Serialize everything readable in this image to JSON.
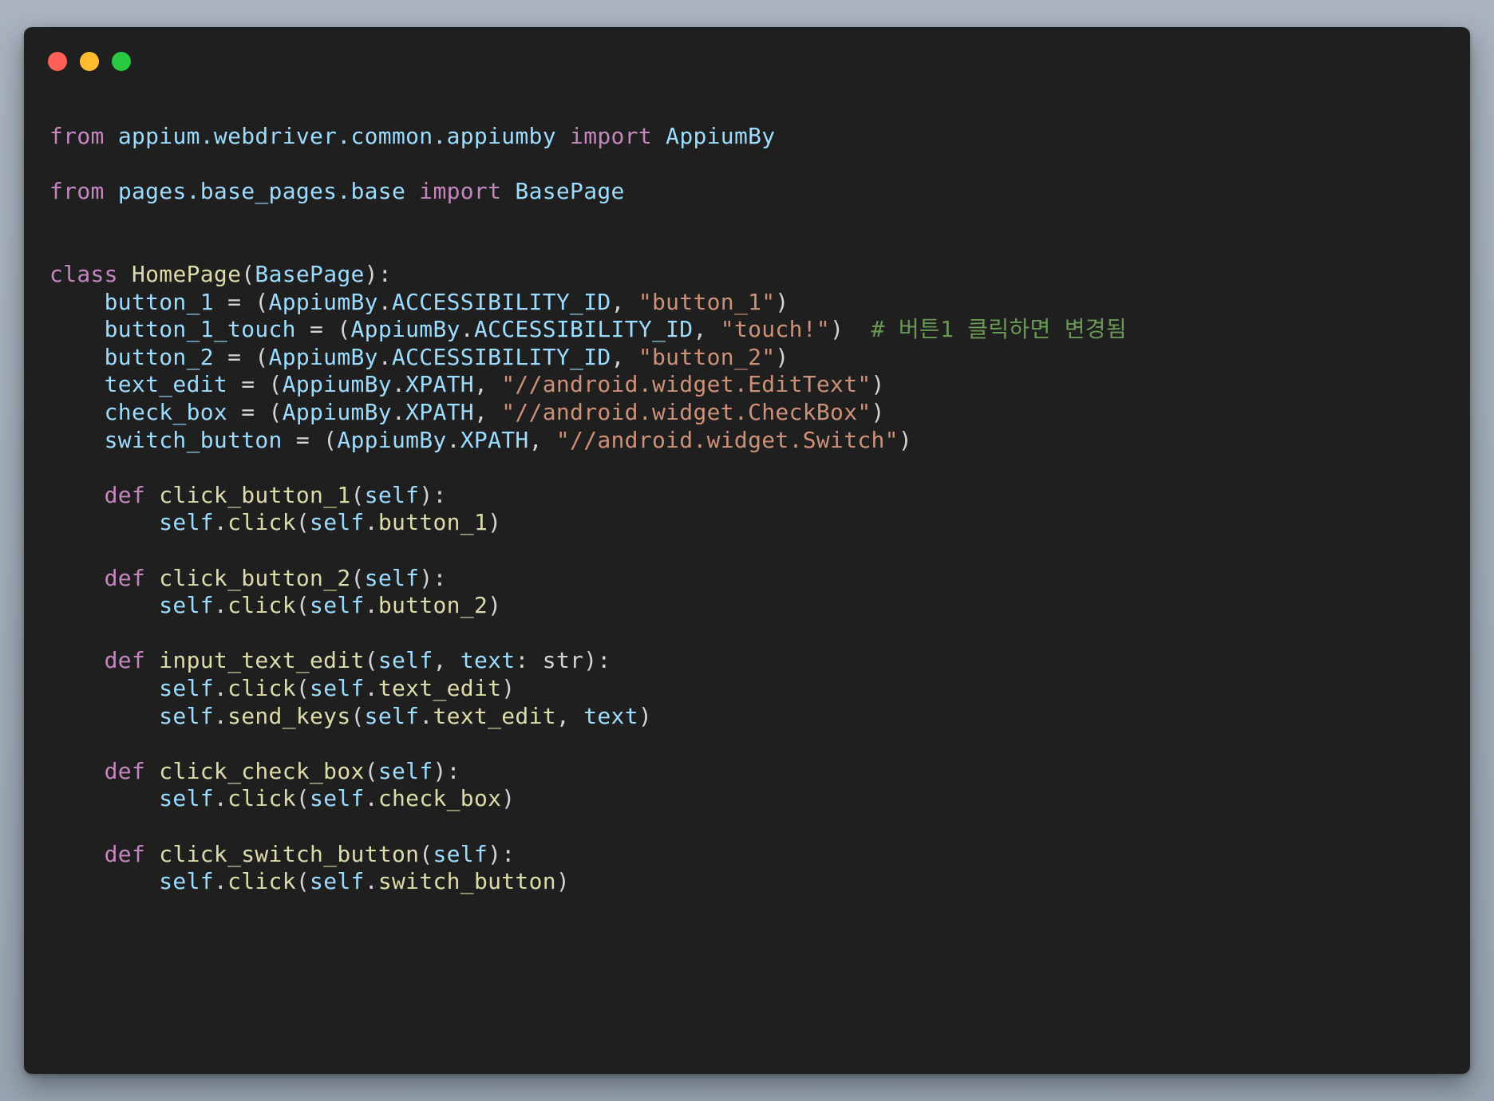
{
  "theme": {
    "background": "#1f1f1f",
    "traffic_lights": {
      "close": "#fe5f57",
      "minimize": "#febc2e",
      "maximize": "#28c840"
    },
    "token_colors": {
      "kw": "#c586c0",
      "mod": "#9cdcfe",
      "cls": "#4ec9b0",
      "fn": "#dcdcaa",
      "var": "#9cdcfe",
      "self": "#9cdcfe",
      "str": "#ce9178",
      "com": "#6a9955",
      "punc": "#d4d4d4",
      "builtin": "#d4d4d4",
      "plain": "#d4d4d4"
    }
  },
  "window_controls": {
    "close_icon": "red-circle",
    "minimize_icon": "yellow-circle",
    "maximize_icon": "green-circle"
  },
  "code_lines": [
    {
      "line": 1,
      "tokens": [
        {
          "t": "kw",
          "v": "from"
        },
        {
          "t": "plain",
          "v": " "
        },
        {
          "t": "mod",
          "v": "appium.webdriver.common.appiumby"
        },
        {
          "t": "plain",
          "v": " "
        },
        {
          "t": "kw",
          "v": "import"
        },
        {
          "t": "plain",
          "v": " "
        },
        {
          "t": "mod",
          "v": "AppiumBy"
        }
      ]
    },
    {
      "line": 3,
      "tokens": [
        {
          "t": "kw",
          "v": "from"
        },
        {
          "t": "plain",
          "v": " "
        },
        {
          "t": "mod",
          "v": "pages.base_pages.base"
        },
        {
          "t": "plain",
          "v": " "
        },
        {
          "t": "kw",
          "v": "import"
        },
        {
          "t": "plain",
          "v": " "
        },
        {
          "t": "mod",
          "v": "BasePage"
        }
      ]
    },
    {
      "line": 6,
      "tokens": [
        {
          "t": "kw",
          "v": "class"
        },
        {
          "t": "plain",
          "v": " "
        },
        {
          "t": "fn",
          "v": "HomePage"
        },
        {
          "t": "punc",
          "v": "("
        },
        {
          "t": "mod",
          "v": "BasePage"
        },
        {
          "t": "punc",
          "v": "):"
        }
      ]
    },
    {
      "line": 7,
      "tokens": [
        {
          "t": "plain",
          "v": "    "
        },
        {
          "t": "var",
          "v": "button_1"
        },
        {
          "t": "punc",
          "v": " = ("
        },
        {
          "t": "var",
          "v": "AppiumBy"
        },
        {
          "t": "punc",
          "v": "."
        },
        {
          "t": "var",
          "v": "ACCESSIBILITY_ID"
        },
        {
          "t": "punc",
          "v": ", "
        },
        {
          "t": "str",
          "v": "\"button_1\""
        },
        {
          "t": "punc",
          "v": ")"
        }
      ]
    },
    {
      "line": 8,
      "tokens": [
        {
          "t": "plain",
          "v": "    "
        },
        {
          "t": "var",
          "v": "button_1_touch"
        },
        {
          "t": "punc",
          "v": " = ("
        },
        {
          "t": "var",
          "v": "AppiumBy"
        },
        {
          "t": "punc",
          "v": "."
        },
        {
          "t": "var",
          "v": "ACCESSIBILITY_ID"
        },
        {
          "t": "punc",
          "v": ", "
        },
        {
          "t": "str",
          "v": "\"touch!\""
        },
        {
          "t": "punc",
          "v": ")  "
        },
        {
          "t": "com",
          "v": "# 버튼1 클릭하면 변경됨"
        }
      ]
    },
    {
      "line": 9,
      "tokens": [
        {
          "t": "plain",
          "v": "    "
        },
        {
          "t": "var",
          "v": "button_2"
        },
        {
          "t": "punc",
          "v": " = ("
        },
        {
          "t": "var",
          "v": "AppiumBy"
        },
        {
          "t": "punc",
          "v": "."
        },
        {
          "t": "var",
          "v": "ACCESSIBILITY_ID"
        },
        {
          "t": "punc",
          "v": ", "
        },
        {
          "t": "str",
          "v": "\"button_2\""
        },
        {
          "t": "punc",
          "v": ")"
        }
      ]
    },
    {
      "line": 10,
      "tokens": [
        {
          "t": "plain",
          "v": "    "
        },
        {
          "t": "var",
          "v": "text_edit"
        },
        {
          "t": "punc",
          "v": " = ("
        },
        {
          "t": "var",
          "v": "AppiumBy"
        },
        {
          "t": "punc",
          "v": "."
        },
        {
          "t": "var",
          "v": "XPATH"
        },
        {
          "t": "punc",
          "v": ", "
        },
        {
          "t": "str",
          "v": "\"//android.widget.EditText\""
        },
        {
          "t": "punc",
          "v": ")"
        }
      ]
    },
    {
      "line": 11,
      "tokens": [
        {
          "t": "plain",
          "v": "    "
        },
        {
          "t": "var",
          "v": "check_box"
        },
        {
          "t": "punc",
          "v": " = ("
        },
        {
          "t": "var",
          "v": "AppiumBy"
        },
        {
          "t": "punc",
          "v": "."
        },
        {
          "t": "var",
          "v": "XPATH"
        },
        {
          "t": "punc",
          "v": ", "
        },
        {
          "t": "str",
          "v": "\"//android.widget.CheckBox\""
        },
        {
          "t": "punc",
          "v": ")"
        }
      ]
    },
    {
      "line": 12,
      "tokens": [
        {
          "t": "plain",
          "v": "    "
        },
        {
          "t": "var",
          "v": "switch_button"
        },
        {
          "t": "punc",
          "v": " = ("
        },
        {
          "t": "var",
          "v": "AppiumBy"
        },
        {
          "t": "punc",
          "v": "."
        },
        {
          "t": "var",
          "v": "XPATH"
        },
        {
          "t": "punc",
          "v": ", "
        },
        {
          "t": "str",
          "v": "\"//android.widget.Switch\""
        },
        {
          "t": "punc",
          "v": ")"
        }
      ]
    },
    {
      "line": 14,
      "tokens": [
        {
          "t": "plain",
          "v": "    "
        },
        {
          "t": "kw",
          "v": "def"
        },
        {
          "t": "plain",
          "v": " "
        },
        {
          "t": "fn",
          "v": "click_button_1"
        },
        {
          "t": "punc",
          "v": "("
        },
        {
          "t": "self",
          "v": "self"
        },
        {
          "t": "punc",
          "v": "):"
        }
      ]
    },
    {
      "line": 15,
      "tokens": [
        {
          "t": "plain",
          "v": "        "
        },
        {
          "t": "self",
          "v": "self"
        },
        {
          "t": "punc",
          "v": "."
        },
        {
          "t": "fn",
          "v": "click"
        },
        {
          "t": "punc",
          "v": "("
        },
        {
          "t": "self",
          "v": "self"
        },
        {
          "t": "punc",
          "v": "."
        },
        {
          "t": "fn",
          "v": "button_1"
        },
        {
          "t": "punc",
          "v": ")"
        }
      ]
    },
    {
      "line": 17,
      "tokens": [
        {
          "t": "plain",
          "v": "    "
        },
        {
          "t": "kw",
          "v": "def"
        },
        {
          "t": "plain",
          "v": " "
        },
        {
          "t": "fn",
          "v": "click_button_2"
        },
        {
          "t": "punc",
          "v": "("
        },
        {
          "t": "self",
          "v": "self"
        },
        {
          "t": "punc",
          "v": "):"
        }
      ]
    },
    {
      "line": 18,
      "tokens": [
        {
          "t": "plain",
          "v": "        "
        },
        {
          "t": "self",
          "v": "self"
        },
        {
          "t": "punc",
          "v": "."
        },
        {
          "t": "fn",
          "v": "click"
        },
        {
          "t": "punc",
          "v": "("
        },
        {
          "t": "self",
          "v": "self"
        },
        {
          "t": "punc",
          "v": "."
        },
        {
          "t": "fn",
          "v": "button_2"
        },
        {
          "t": "punc",
          "v": ")"
        }
      ]
    },
    {
      "line": 20,
      "tokens": [
        {
          "t": "plain",
          "v": "    "
        },
        {
          "t": "kw",
          "v": "def"
        },
        {
          "t": "plain",
          "v": " "
        },
        {
          "t": "fn",
          "v": "input_text_edit"
        },
        {
          "t": "punc",
          "v": "("
        },
        {
          "t": "self",
          "v": "self"
        },
        {
          "t": "punc",
          "v": ", "
        },
        {
          "t": "var",
          "v": "text"
        },
        {
          "t": "punc",
          "v": ": "
        },
        {
          "t": "builtin",
          "v": "str"
        },
        {
          "t": "punc",
          "v": "):"
        }
      ]
    },
    {
      "line": 21,
      "tokens": [
        {
          "t": "plain",
          "v": "        "
        },
        {
          "t": "self",
          "v": "self"
        },
        {
          "t": "punc",
          "v": "."
        },
        {
          "t": "fn",
          "v": "click"
        },
        {
          "t": "punc",
          "v": "("
        },
        {
          "t": "self",
          "v": "self"
        },
        {
          "t": "punc",
          "v": "."
        },
        {
          "t": "fn",
          "v": "text_edit"
        },
        {
          "t": "punc",
          "v": ")"
        }
      ]
    },
    {
      "line": 22,
      "tokens": [
        {
          "t": "plain",
          "v": "        "
        },
        {
          "t": "self",
          "v": "self"
        },
        {
          "t": "punc",
          "v": "."
        },
        {
          "t": "fn",
          "v": "send_keys"
        },
        {
          "t": "punc",
          "v": "("
        },
        {
          "t": "self",
          "v": "self"
        },
        {
          "t": "punc",
          "v": "."
        },
        {
          "t": "fn",
          "v": "text_edit"
        },
        {
          "t": "punc",
          "v": ", "
        },
        {
          "t": "var",
          "v": "text"
        },
        {
          "t": "punc",
          "v": ")"
        }
      ]
    },
    {
      "line": 24,
      "tokens": [
        {
          "t": "plain",
          "v": "    "
        },
        {
          "t": "kw",
          "v": "def"
        },
        {
          "t": "plain",
          "v": " "
        },
        {
          "t": "fn",
          "v": "click_check_box"
        },
        {
          "t": "punc",
          "v": "("
        },
        {
          "t": "self",
          "v": "self"
        },
        {
          "t": "punc",
          "v": "):"
        }
      ]
    },
    {
      "line": 25,
      "tokens": [
        {
          "t": "plain",
          "v": "        "
        },
        {
          "t": "self",
          "v": "self"
        },
        {
          "t": "punc",
          "v": "."
        },
        {
          "t": "fn",
          "v": "click"
        },
        {
          "t": "punc",
          "v": "("
        },
        {
          "t": "self",
          "v": "self"
        },
        {
          "t": "punc",
          "v": "."
        },
        {
          "t": "fn",
          "v": "check_box"
        },
        {
          "t": "punc",
          "v": ")"
        }
      ]
    },
    {
      "line": 27,
      "tokens": [
        {
          "t": "plain",
          "v": "    "
        },
        {
          "t": "kw",
          "v": "def"
        },
        {
          "t": "plain",
          "v": " "
        },
        {
          "t": "fn",
          "v": "click_switch_button"
        },
        {
          "t": "punc",
          "v": "("
        },
        {
          "t": "self",
          "v": "self"
        },
        {
          "t": "punc",
          "v": "):"
        }
      ]
    },
    {
      "line": 28,
      "tokens": [
        {
          "t": "plain",
          "v": "        "
        },
        {
          "t": "self",
          "v": "self"
        },
        {
          "t": "punc",
          "v": "."
        },
        {
          "t": "fn",
          "v": "click"
        },
        {
          "t": "punc",
          "v": "("
        },
        {
          "t": "self",
          "v": "self"
        },
        {
          "t": "punc",
          "v": "."
        },
        {
          "t": "fn",
          "v": "switch_button"
        },
        {
          "t": "punc",
          "v": ")"
        }
      ]
    }
  ]
}
